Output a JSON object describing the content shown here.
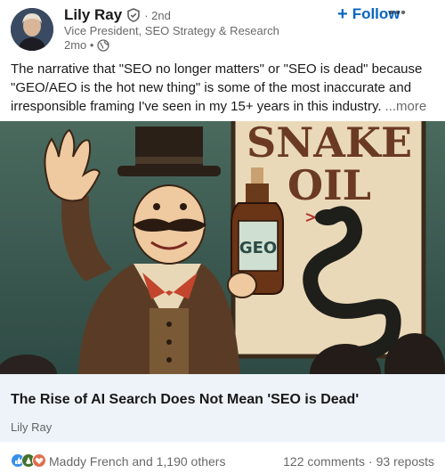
{
  "author": {
    "name": "Lily Ray",
    "degree": "· 2nd",
    "headline": "Vice President, SEO Strategy & Research",
    "time": "2mo •"
  },
  "actions": {
    "follow_label": "Follow",
    "follow_plus": "+",
    "more_label": "•••"
  },
  "post": {
    "text": "The narrative that \"SEO no longer matters\" or \"SEO is dead\" because \"GEO/AEO is the hot new thing\" is some of the most inaccurate and irresponsible framing I've seen in my 15+ years in this industry.",
    "see_more": "...more"
  },
  "image": {
    "sign_line1": "SNAKE",
    "sign_line2": "OIL",
    "bottle_label": "GEO"
  },
  "article": {
    "title": "The Rise of AI Search Does Not Mean 'SEO is Dead'",
    "source": "Lily Ray"
  },
  "social": {
    "reactions_text": "Maddy French and 1,190 others",
    "comments": "122 comments",
    "separator": "·",
    "reposts": "93 reposts"
  },
  "colors": {
    "accent": "#0a66c2",
    "card_bg": "#edf3f8"
  },
  "icons": [
    "verified-icon",
    "globe-icon",
    "like-reaction-icon",
    "celebrate-reaction-icon",
    "love-reaction-icon"
  ]
}
